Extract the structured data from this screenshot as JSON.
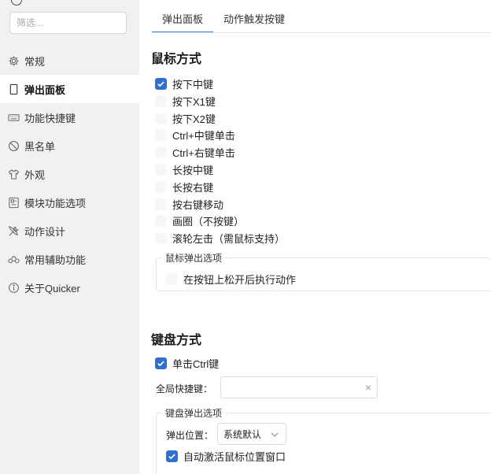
{
  "sidebar": {
    "filter_placeholder": "筛选...",
    "items": [
      {
        "label": "常规",
        "icon": "gear-icon"
      },
      {
        "label": "弹出面板",
        "icon": "panel-icon"
      },
      {
        "label": "功能快捷键",
        "icon": "keyboard-icon"
      },
      {
        "label": "黑名单",
        "icon": "prohibit-icon"
      },
      {
        "label": "外观",
        "icon": "shirt-icon"
      },
      {
        "label": "模块功能选项",
        "icon": "module-icon"
      },
      {
        "label": "动作设计",
        "icon": "tools-icon"
      },
      {
        "label": "常用辅助功能",
        "icon": "accessibility-icon"
      },
      {
        "label": "关于Quicker",
        "icon": "info-icon"
      }
    ],
    "active_index": 1
  },
  "tabs": [
    {
      "label": "弹出面板",
      "active": true
    },
    {
      "label": "动作触发按键",
      "active": false
    }
  ],
  "mouse": {
    "title": "鼠标方式",
    "options": [
      {
        "label": "按下中键",
        "checked": true
      },
      {
        "label": "按下X1键",
        "checked": false
      },
      {
        "label": "按下X2键",
        "checked": false
      },
      {
        "label": "Ctrl+中键单击",
        "checked": false
      },
      {
        "label": "Ctrl+右键单击",
        "checked": false
      },
      {
        "label": "长按中键",
        "checked": false
      },
      {
        "label": "长按右键",
        "checked": false
      },
      {
        "label": "按右键移动",
        "checked": false
      },
      {
        "label": "画圈（不按键）",
        "checked": false
      },
      {
        "label": "滚轮左击（需鼠标支持）",
        "checked": false
      }
    ],
    "popup_group": {
      "title": "鼠标弹出选项",
      "option": {
        "label": "在按钮上松开后执行动作",
        "checked": false
      }
    }
  },
  "keyboard": {
    "title": "键盘方式",
    "ctrl_option": {
      "label": "单击Ctrl键",
      "checked": true
    },
    "hotkey_label": "全局快捷键：",
    "hotkey_value": "",
    "clear_glyph": "×",
    "popup_group": {
      "title": "键盘弹出选项",
      "position_label": "弹出位置：",
      "position_value": "系统默认",
      "auto_activate": {
        "label": "自动激活鼠标位置窗口",
        "checked": true
      }
    }
  },
  "colors": {
    "accent": "#3b7ed6",
    "checkbox_checked": "#2f6fcf",
    "sidebar_bg": "#f1f1f1"
  }
}
